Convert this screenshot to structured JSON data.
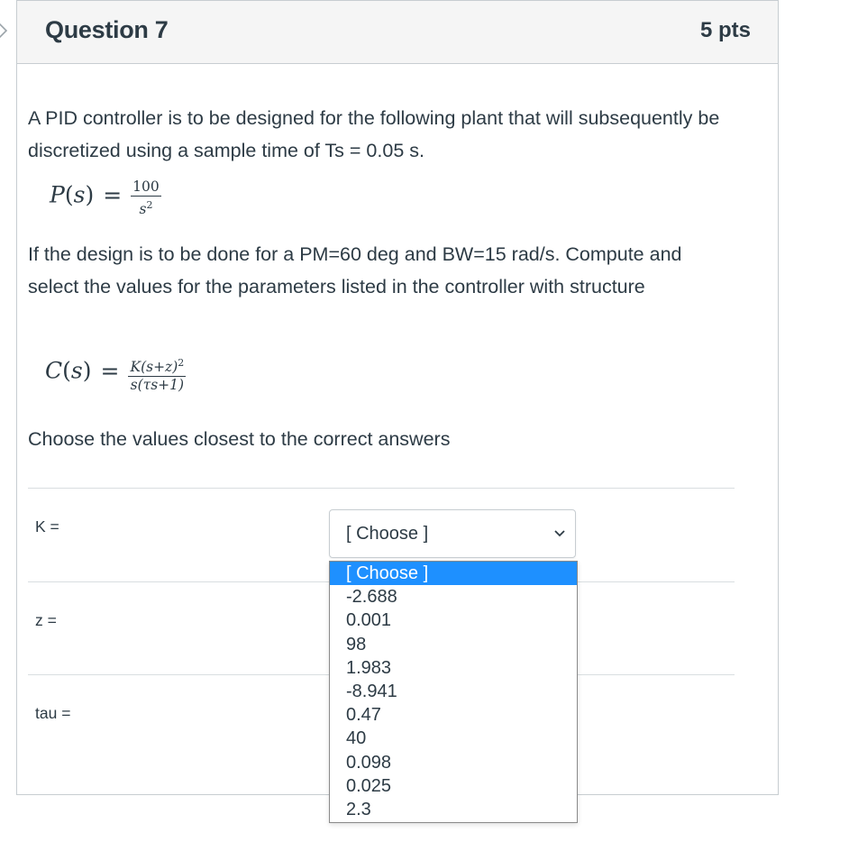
{
  "question": {
    "title": "Question 7",
    "points": "5 pts",
    "intro": "A PID controller is to be designed for the following plant that will subsequently be discretized using a sample time of Ts = 0.05 s.",
    "plant": {
      "lhs_fn": "P",
      "lhs_var": "s",
      "equals": "=",
      "numerator": "100",
      "denominator_base": "s",
      "denominator_exp": "2"
    },
    "design_text": "If the design is to be done for a PM=60 deg and BW=15 rad/s. Compute and select the values for the parameters listed in the controller with structure",
    "controller": {
      "lhs_fn": "C",
      "lhs_var": "s",
      "equals": "=",
      "num_K": "K",
      "num_inner": "(s+z)",
      "num_exp": "2",
      "den_s": "s",
      "den_inner": "(τs+1)"
    },
    "instruction": "Choose the values closest to the correct answers",
    "rows": [
      {
        "label": "K ="
      },
      {
        "label": "z ="
      },
      {
        "label": "tau ="
      }
    ],
    "select": {
      "value": "[ Choose ]",
      "options": [
        "[ Choose ]",
        "-2.688",
        "0.001",
        "98",
        "1.983",
        "-8.941",
        "0.47",
        "40",
        "0.098",
        "0.025",
        "2.3"
      ],
      "highlighted_index": 0
    }
  },
  "icons": {
    "nav": "chevron-right-icon",
    "select": "chevron-down-icon"
  },
  "colors": {
    "text": "#2d3b45",
    "header_bg": "#f5f5f5",
    "border": "#c7cdd1",
    "highlight": "#1e90ff"
  }
}
